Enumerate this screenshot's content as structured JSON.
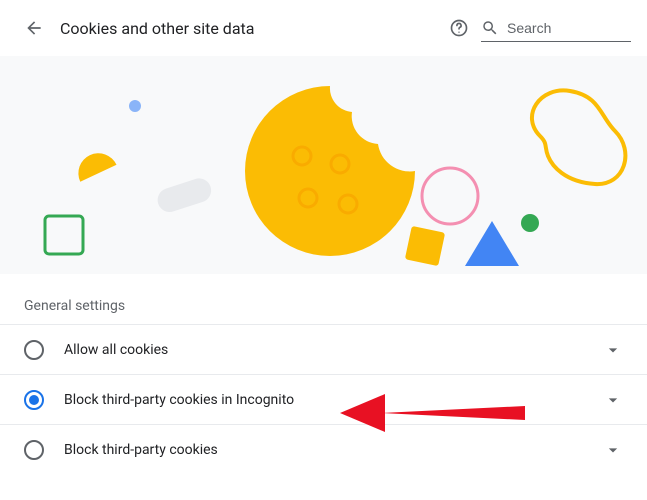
{
  "header": {
    "title": "Cookies and other site data",
    "search_placeholder": "Search"
  },
  "section_label": "General settings",
  "options": [
    {
      "label": "Allow all cookies",
      "checked": false
    },
    {
      "label": "Block third-party cookies in Incognito",
      "checked": true
    },
    {
      "label": "Block third-party cookies",
      "checked": false
    }
  ],
  "icons": {
    "back": "back-arrow-icon",
    "help": "help-icon",
    "search": "search-icon",
    "expand": "chevron-down-icon"
  }
}
